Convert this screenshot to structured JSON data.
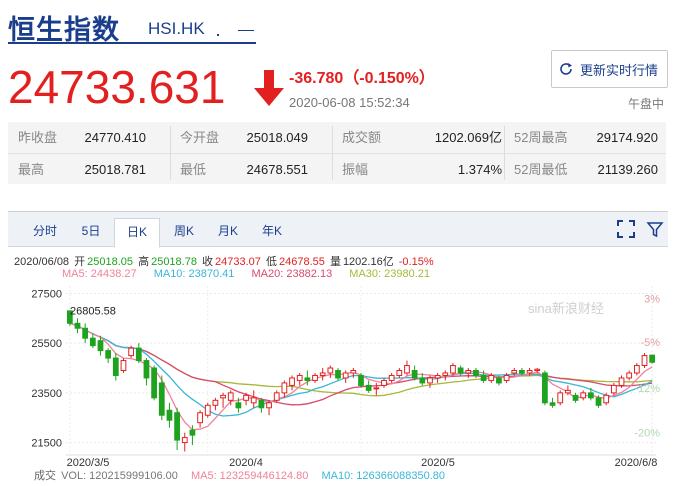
{
  "header": {
    "title": "恒生指数",
    "symbol": "HSI.HK",
    "price": "24733.631",
    "change": "-36.780（-0.150%）",
    "datetime": "2020-06-08 15:52:34",
    "refresh_label": "更新实时行情",
    "market_status": "午盘中"
  },
  "stats": {
    "row1": [
      {
        "label": "昨收盘",
        "value": "24770.410"
      },
      {
        "label": "今开盘",
        "value": "25018.049"
      },
      {
        "label": "成交额",
        "value": "1202.069亿"
      },
      {
        "label": "52周最高",
        "value": "29174.920"
      }
    ],
    "row2": [
      {
        "label": "最高",
        "value": "25018.781"
      },
      {
        "label": "最低",
        "value": "24678.551"
      },
      {
        "label": "振幅",
        "value": "1.374%"
      },
      {
        "label": "52周最低",
        "value": "21139.260"
      }
    ]
  },
  "tabs": [
    {
      "label": "分时",
      "active": false
    },
    {
      "label": "5日",
      "active": false
    },
    {
      "label": "日K",
      "active": true
    },
    {
      "label": "周K",
      "active": false
    },
    {
      "label": "月K",
      "active": false
    },
    {
      "label": "年K",
      "active": false
    }
  ],
  "icons": {
    "fullscreen": "fullscreen-icon",
    "settings": "settings-icon",
    "refresh": "refresh-icon",
    "down_arrow": "down-arrow-icon"
  },
  "colors": {
    "up": "#e32020",
    "down": "#1ea31e",
    "accent": "#1a3e8c",
    "ma5": "#f0829a",
    "ma10": "#3ab6d8",
    "ma20": "#d84a6e",
    "ma30": "#a6b93a"
  },
  "info": {
    "line1": [
      {
        "text": "2020/06/08",
        "color": "#333"
      },
      {
        "text": "开",
        "color": "#333"
      },
      {
        "text": "25018.05",
        "color": "#1ea31e"
      },
      {
        "text": "高",
        "color": "#333"
      },
      {
        "text": "25018.78",
        "color": "#1ea31e"
      },
      {
        "text": "收",
        "color": "#333"
      },
      {
        "text": "24733.07",
        "color": "#e32020"
      },
      {
        "text": "低",
        "color": "#333"
      },
      {
        "text": "24678.55",
        "color": "#e32020"
      },
      {
        "text": "量",
        "color": "#333"
      },
      {
        "text": "1202.16亿",
        "color": "#333"
      },
      {
        "text": "-0.15%",
        "color": "#e32020"
      }
    ],
    "line2": [
      {
        "text": "MA5: 24438.27",
        "color": "#f0829a"
      },
      {
        "text": "MA10: 23870.41",
        "color": "#3ab6d8"
      },
      {
        "text": "MA20: 23882.13",
        "color": "#d84a6e"
      },
      {
        "text": "MA30: 23980.21",
        "color": "#a6b93a"
      }
    ]
  },
  "chart": {
    "y_ticks": [
      "27500",
      "25500",
      "23500",
      "21500"
    ],
    "pct_ticks": [
      {
        "text": "3%",
        "color": "#e0a0a0"
      },
      {
        "text": "-5%",
        "color": "#e0a0a0"
      },
      {
        "text": "-12%",
        "color": "#b0d8b0"
      },
      {
        "text": "-20%",
        "color": "#b0d8b0"
      }
    ],
    "x_ticks": [
      "2020/3/5",
      "2020/4",
      "2020/5",
      "2020/6/8"
    ],
    "high_label": "26805.58",
    "low_label": "21139.26",
    "watermark": "sina新浪财经"
  },
  "volume": {
    "label": "成交",
    "vol": "VOL: 120215999106.00",
    "ma5": "MA5: 123259446124.80",
    "ma10": "MA10: 126366088350.80"
  },
  "chart_data": {
    "type": "candlestick",
    "y_range": [
      21000,
      27800
    ],
    "high_annotation": 26805.58,
    "low_annotation": 21139.26,
    "ohlc": [
      [
        26800,
        26805,
        26200,
        26300
      ],
      [
        26300,
        26500,
        25900,
        26100
      ],
      [
        26100,
        26300,
        25500,
        25700
      ],
      [
        25700,
        25900,
        25300,
        25400
      ],
      [
        25600,
        25800,
        25000,
        25200
      ],
      [
        25200,
        25300,
        24700,
        24900
      ],
      [
        24900,
        25100,
        24000,
        24200
      ],
      [
        24400,
        24900,
        24300,
        24800
      ],
      [
        25000,
        25400,
        24900,
        25300
      ],
      [
        25300,
        25500,
        24700,
        24800
      ],
      [
        24800,
        24900,
        23800,
        24100
      ],
      [
        24500,
        24600,
        23200,
        23300
      ],
      [
        23900,
        24200,
        22400,
        22600
      ],
      [
        22800,
        23100,
        22100,
        22400
      ],
      [
        22700,
        22900,
        21200,
        21600
      ],
      [
        21500,
        21900,
        21139,
        21700
      ],
      [
        22000,
        22200,
        21400,
        21800
      ],
      [
        22300,
        22800,
        22100,
        22700
      ],
      [
        22600,
        23100,
        22500,
        23000
      ],
      [
        23000,
        23300,
        22800,
        23200
      ],
      [
        23300,
        23500,
        22900,
        23400
      ],
      [
        23200,
        23600,
        23000,
        23500
      ],
      [
        23100,
        23300,
        22700,
        22900
      ],
      [
        23200,
        23500,
        23000,
        23400
      ],
      [
        23100,
        23600,
        22900,
        23300
      ],
      [
        23200,
        23300,
        22700,
        22900
      ],
      [
        22900,
        23200,
        22600,
        23100
      ],
      [
        23200,
        23600,
        23100,
        23500
      ],
      [
        23500,
        24000,
        23300,
        23900
      ],
      [
        23800,
        24200,
        23600,
        24100
      ],
      [
        24000,
        24300,
        23800,
        24200
      ],
      [
        24100,
        24400,
        23800,
        24000
      ],
      [
        24000,
        24300,
        23900,
        24200
      ],
      [
        24200,
        24500,
        24000,
        24300
      ],
      [
        24300,
        24600,
        24100,
        24500
      ],
      [
        24400,
        24500,
        24000,
        24100
      ],
      [
        24100,
        24400,
        23900,
        24300
      ],
      [
        24300,
        24500,
        24100,
        24400
      ],
      [
        24200,
        24300,
        23700,
        23800
      ],
      [
        23800,
        24000,
        23500,
        23600
      ],
      [
        23700,
        23900,
        23400,
        23700
      ],
      [
        23800,
        24100,
        23700,
        24000
      ],
      [
        24000,
        24300,
        23900,
        24200
      ],
      [
        24200,
        24500,
        24100,
        24400
      ],
      [
        24300,
        24800,
        24200,
        24600
      ],
      [
        24400,
        24600,
        24000,
        24100
      ],
      [
        24100,
        24300,
        23800,
        23900
      ],
      [
        23900,
        24200,
        23700,
        24100
      ],
      [
        24100,
        24300,
        23900,
        24200
      ],
      [
        24200,
        24400,
        24000,
        24300
      ],
      [
        24300,
        24700,
        24200,
        24600
      ],
      [
        24500,
        24600,
        24200,
        24300
      ],
      [
        24300,
        24500,
        24100,
        24400
      ],
      [
        24400,
        24500,
        24100,
        24200
      ],
      [
        24200,
        24400,
        23900,
        24000
      ],
      [
        24000,
        24300,
        23900,
        24200
      ],
      [
        24100,
        24200,
        23800,
        23900
      ],
      [
        24000,
        24300,
        23900,
        24200
      ],
      [
        24300,
        24500,
        24200,
        24400
      ],
      [
        24400,
        24500,
        24200,
        24300
      ],
      [
        24300,
        24500,
        24200,
        24400
      ],
      [
        24400,
        24500,
        24300,
        24450
      ],
      [
        24300,
        24400,
        23000,
        23100
      ],
      [
        23100,
        23300,
        22900,
        23000
      ],
      [
        23100,
        23600,
        23000,
        23500
      ],
      [
        23500,
        23800,
        23400,
        23600
      ],
      [
        23400,
        23500,
        23100,
        23200
      ],
      [
        23300,
        23600,
        23200,
        23500
      ],
      [
        23500,
        23700,
        23200,
        23300
      ],
      [
        23300,
        23400,
        22900,
        23000
      ],
      [
        23100,
        23500,
        23000,
        23400
      ],
      [
        23500,
        23900,
        23400,
        23800
      ],
      [
        23800,
        24200,
        23700,
        24100
      ],
      [
        24100,
        24400,
        24000,
        24300
      ],
      [
        24300,
        24700,
        24200,
        24600
      ],
      [
        24600,
        25100,
        24500,
        25000
      ],
      [
        25018,
        25019,
        24679,
        24733
      ]
    ]
  }
}
